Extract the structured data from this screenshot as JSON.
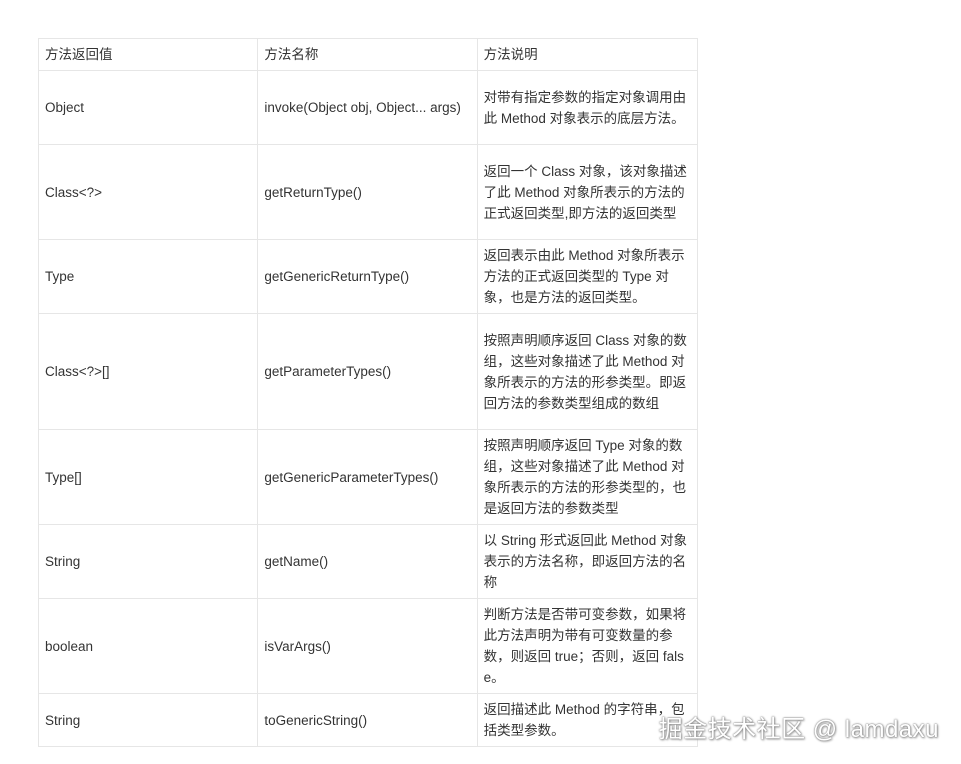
{
  "table": {
    "headers": [
      "方法返回值",
      "方法名称",
      "方法说明"
    ],
    "rows": [
      {
        "return_type": "Object",
        "name": "invoke(Object obj, Object... args)",
        "description": "对带有指定参数的指定对象调用由此 Method 对象表示的底层方法。"
      },
      {
        "return_type": "Class<?>",
        "name": "getReturnType()",
        "description": "返回一个 Class 对象，该对象描述了此 Method 对象所表示的方法的正式返回类型,即方法的返回类型"
      },
      {
        "return_type": "Type",
        "name": "getGenericReturnType()",
        "description": "返回表示由此 Method 对象所表示方法的正式返回类型的 Type 对象，也是方法的返回类型。"
      },
      {
        "return_type": "Class<?>[]",
        "name": "getParameterTypes()",
        "description": "按照声明顺序返回 Class 对象的数组，这些对象描述了此 Method 对象所表示的方法的形参类型。即返回方法的参数类型组成的数组"
      },
      {
        "return_type": "Type[]",
        "name": "getGenericParameterTypes()",
        "description": "按照声明顺序返回 Type 对象的数组，这些对象描述了此 Method 对象所表示的方法的形参类型的，也是返回方法的参数类型"
      },
      {
        "return_type": "String",
        "name": "getName()",
        "description": "以 String 形式返回此 Method 对象表示的方法名称，即返回方法的名称"
      },
      {
        "return_type": "boolean",
        "name": "isVarArgs()",
        "description": "判断方法是否带可变参数，如果将此方法声明为带有可变数量的参数，则返回 true；否则，返回 false。"
      },
      {
        "return_type": "String",
        "name": "toGenericString()",
        "description": "返回描述此 Method 的字符串，包括类型参数。"
      }
    ]
  },
  "watermark": "掘金技术社区 @ lamdaxu"
}
